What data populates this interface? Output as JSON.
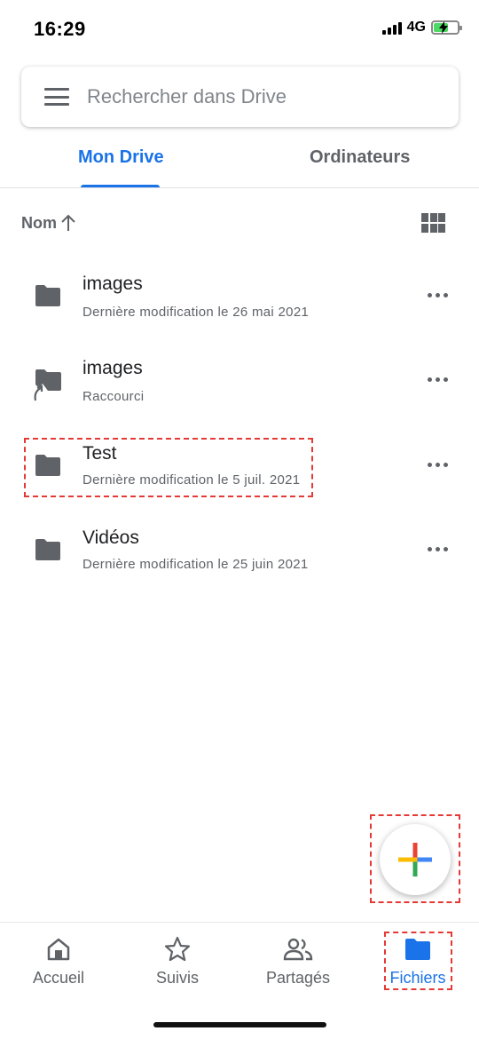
{
  "status_bar": {
    "time": "16:29",
    "network": "4G"
  },
  "search": {
    "placeholder": "Rechercher dans Drive"
  },
  "tabs": [
    {
      "label": "Mon Drive",
      "active": true
    },
    {
      "label": "Ordinateurs",
      "active": false
    }
  ],
  "sort": {
    "label": "Nom"
  },
  "files": [
    {
      "name": "images",
      "subtitle": "Dernière modification le 26 mai 2021",
      "icon": "folder-icon"
    },
    {
      "name": "images",
      "subtitle": "Raccourci",
      "icon": "folder-shortcut-icon"
    },
    {
      "name": "Test",
      "subtitle": "Dernière modification le 5 juil. 2021",
      "icon": "folder-icon"
    },
    {
      "name": "Vidéos",
      "subtitle": "Dernière modification le 25 juin 2021",
      "icon": "folder-icon"
    }
  ],
  "bottom_nav": [
    {
      "label": "Accueil",
      "icon": "home-icon"
    },
    {
      "label": "Suivis",
      "icon": "star-icon"
    },
    {
      "label": "Partagés",
      "icon": "people-icon"
    },
    {
      "label": "Fichiers",
      "icon": "folder-icon",
      "active": true
    }
  ],
  "colors": {
    "accent": "#1a73e8",
    "icon_gray": "#5f6368",
    "highlight": "#e53935"
  }
}
